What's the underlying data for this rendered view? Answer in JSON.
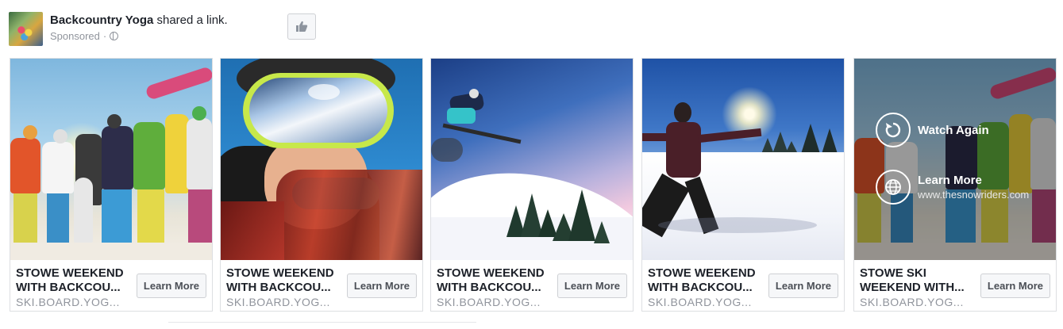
{
  "post": {
    "page_name": "Backcountry Yoga",
    "action_text": " shared a link.",
    "sponsored": "Sponsored",
    "separator": "·",
    "privacy_icon": "globe-icon",
    "like_icon": "thumbs-up-icon"
  },
  "cards": [
    {
      "title_line1": "STOWE WEEKEND",
      "title_line2": "WITH BACKCOU...",
      "domain": "SKI.BOARD.YOG...",
      "cta": "Learn More"
    },
    {
      "title_line1": "STOWE WEEKEND",
      "title_line2": "WITH BACKCOU...",
      "domain": "SKI.BOARD.YOG...",
      "cta": "Learn More"
    },
    {
      "title_line1": "STOWE WEEKEND",
      "title_line2": "WITH BACKCOU...",
      "domain": "SKI.BOARD.YOG...",
      "cta": "Learn More"
    },
    {
      "title_line1": "STOWE WEEKEND",
      "title_line2": "WITH BACKCOU...",
      "domain": "SKI.BOARD.YOG...",
      "cta": "Learn More"
    },
    {
      "title_line1": "STOWE SKI",
      "title_line2": "WEEKEND WITH...",
      "domain": "SKI.BOARD.YOG...",
      "cta": "Learn More"
    }
  ],
  "video_overlay": {
    "watch_again": "Watch Again",
    "learn_more": "Learn More",
    "url": "www.thesnowriders.com",
    "replay_icon": "replay-icon",
    "globe_icon": "globe-icon"
  },
  "colors": {
    "text_primary": "#1d2129",
    "text_secondary": "#90949c",
    "button_bg": "#f6f7f9",
    "border": "#dddfe2"
  }
}
